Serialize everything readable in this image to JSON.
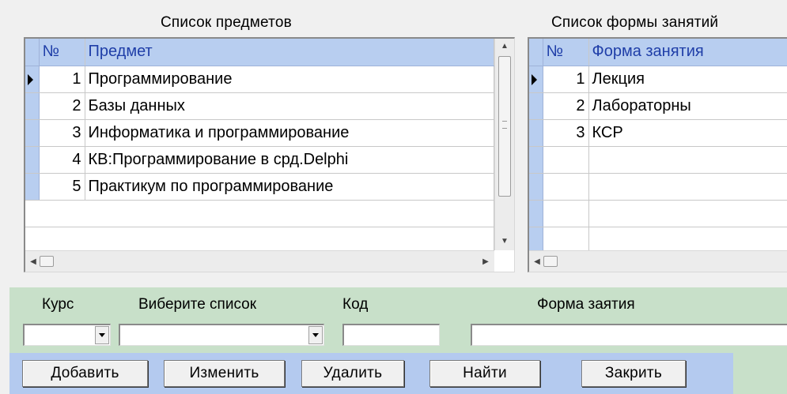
{
  "subjects": {
    "caption": "Список предметов",
    "columns": {
      "num": "№",
      "name": "Предмет"
    },
    "rows": [
      {
        "num": "1",
        "name": "Программирование"
      },
      {
        "num": "2",
        "name": "Базы данных"
      },
      {
        "num": "3",
        "name": "Информатика и программирование"
      },
      {
        "num": "4",
        "name": "КВ:Программирование в срд.Delphi"
      },
      {
        "num": "5",
        "name": "Практикум по программирование"
      }
    ]
  },
  "forms": {
    "caption": "Список формы занятий",
    "columns": {
      "num": "№",
      "name": "Форма занятия"
    },
    "rows": [
      {
        "num": "1",
        "name": "Лекция"
      },
      {
        "num": "2",
        "name": "Лабораторны"
      },
      {
        "num": "3",
        "name": "КСР"
      }
    ]
  },
  "editor": {
    "course_label": "Курс",
    "list_label": "Виберите список",
    "code_label": "Код",
    "form_label": "Форма заятия",
    "course_value": "",
    "list_value": "",
    "code_value": "",
    "form_value": ""
  },
  "buttons": {
    "add": "Добавить",
    "edit": "Изменить",
    "delete": "Удалить",
    "find": "Найти",
    "close": "Закрить"
  },
  "icons": {
    "row_pointer": "triangle-right-icon",
    "scroll_up": "arrow-up-icon",
    "scroll_down": "arrow-down-icon",
    "scroll_left": "arrow-left-icon",
    "scroll_right": "arrow-right-icon",
    "dropdown": "chevron-down-icon"
  }
}
